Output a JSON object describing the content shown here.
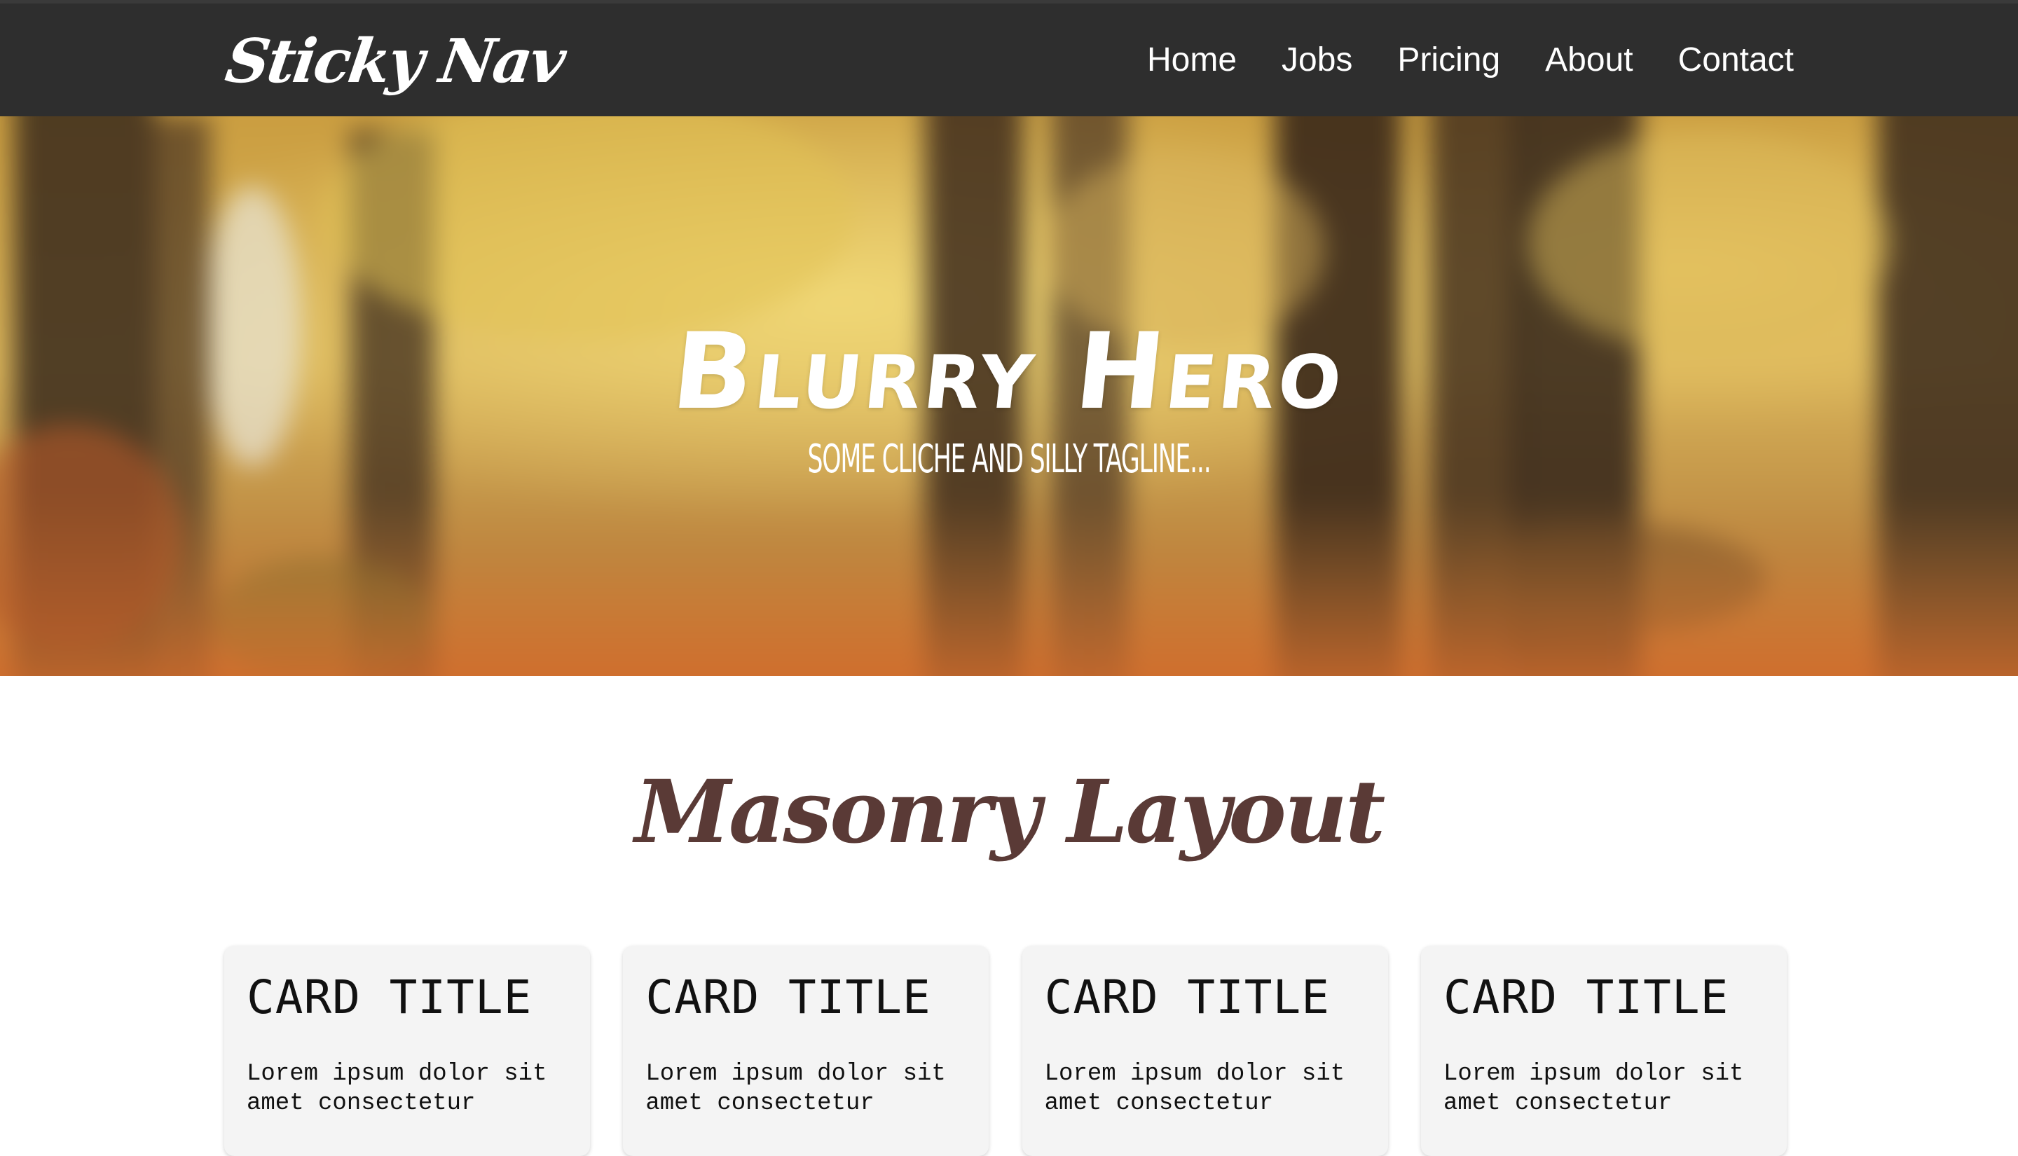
{
  "nav": {
    "logo": "Sticky Nav",
    "links": [
      "Home",
      "Jobs",
      "Pricing",
      "About",
      "Contact"
    ]
  },
  "hero": {
    "title": "Blurry Hero",
    "tagline": "Some cliche and silly tagline..."
  },
  "section": {
    "title": "Masonry Layout"
  },
  "cards": [
    {
      "title": "CARD TITLE",
      "body": "Lorem ipsum dolor sit amet consectetur"
    },
    {
      "title": "CARD TITLE",
      "body": "Lorem ipsum dolor sit amet consectetur"
    },
    {
      "title": "CARD TITLE",
      "body": "Lorem ipsum dolor sit amet consectetur"
    },
    {
      "title": "CARD TITLE",
      "body": "Lorem ipsum dolor sit amet consectetur"
    }
  ],
  "colors": {
    "nav_bg": "#2e2e2e",
    "section_title": "#5a3a36",
    "card_bg": "#f4f4f4"
  }
}
